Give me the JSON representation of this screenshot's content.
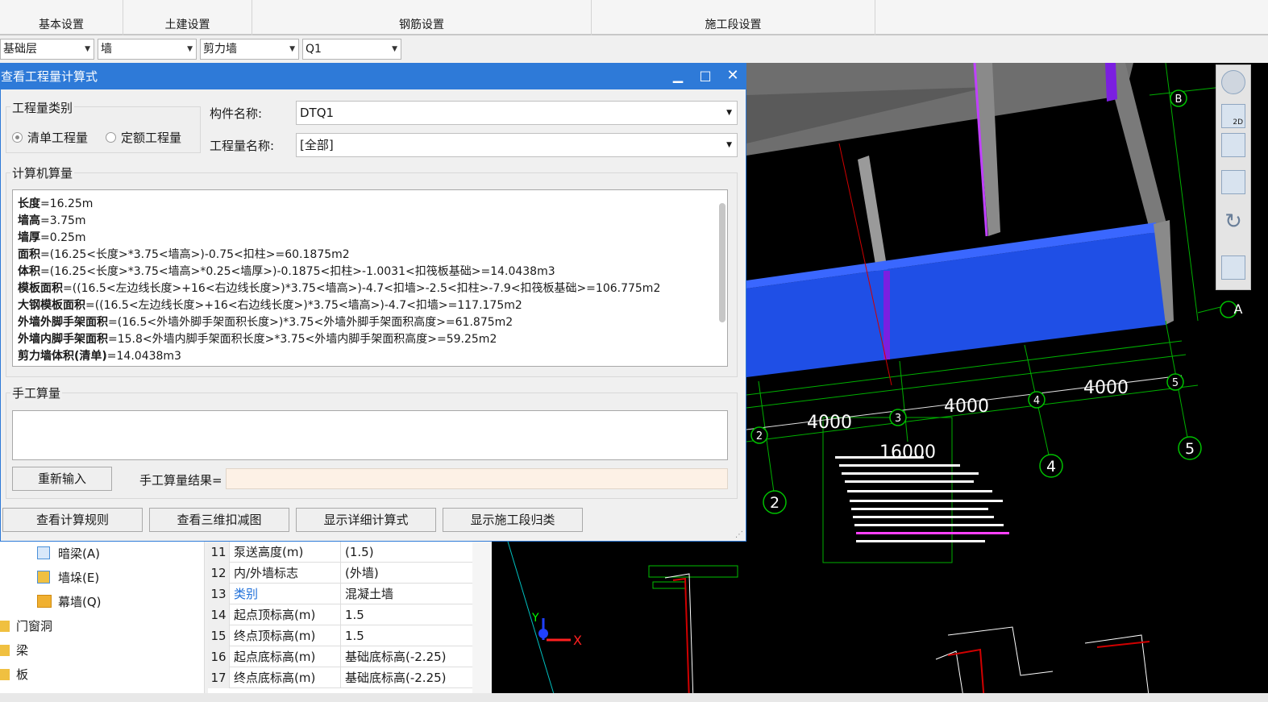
{
  "ribbon": {
    "groups": [
      "基本设置",
      "土建设置",
      "钢筋设置",
      "施工段设置"
    ]
  },
  "selectors": {
    "floor": "基础层",
    "category": "墙",
    "type": "剪力墙",
    "element": "Q1"
  },
  "dialog": {
    "title": "查看工程量计算式",
    "quantity_type": {
      "group_label": "工程量类别",
      "options": [
        "清单工程量",
        "定额工程量"
      ],
      "selected": "清单工程量"
    },
    "component_label": "构件名称:",
    "component_value": "DTQ1",
    "quantity_name_label": "工程量名称:",
    "quantity_name_value": "[全部]",
    "computer_calc_label": "计算机算量",
    "calc_lines": [
      {
        "key": "长度",
        "expr": "=16.25m"
      },
      {
        "key": "墙高",
        "expr": "=3.75m"
      },
      {
        "key": "墙厚",
        "expr": "=0.25m"
      },
      {
        "key": "面积",
        "expr": "=(16.25<长度>*3.75<墙高>)-0.75<扣柱>=60.1875m2"
      },
      {
        "key": "体积",
        "expr": "=(16.25<长度>*3.75<墙高>*0.25<墙厚>)-0.1875<扣柱>-1.0031<扣筏板基础>=14.0438m3"
      },
      {
        "key": "模板面积",
        "expr": "=((16.5<左边线长度>+16<右边线长度>)*3.75<墙高>)-4.7<扣墙>-2.5<扣柱>-7.9<扣筏板基础>=106.775m2"
      },
      {
        "key": "大钢模板面积",
        "expr": "=((16.5<左边线长度>+16<右边线长度>)*3.75<墙高>)-4.7<扣墙>=117.175m2"
      },
      {
        "key": "外墙外脚手架面积",
        "expr": "=(16.5<外墙外脚手架面积长度>)*3.75<外墙外脚手架面积高度>=61.875m2"
      },
      {
        "key": "外墙内脚手架面积",
        "expr": "=15.8<外墙内脚手架面积长度>*3.75<外墙内脚手架面积高度>=59.25m2"
      },
      {
        "key": "剪力墙体积(清单)",
        "expr": "=14.0438m3"
      }
    ],
    "manual_label": "手工算量",
    "reenter_button": "重新输入",
    "manual_result_label": "手工算量结果=",
    "buttons": [
      "查看计算规则",
      "查看三维扣减图",
      "显示详细计算式",
      "显示施工段归类"
    ]
  },
  "tree": {
    "items": [
      {
        "label": "暗梁(A)",
        "icon": "beam-icon"
      },
      {
        "label": "墙垛(E)",
        "icon": "pilaster-icon"
      },
      {
        "label": "幕墙(Q)",
        "icon": "curtain-wall-icon"
      },
      {
        "label": "门窗洞",
        "icon": "folder-icon"
      },
      {
        "label": "梁",
        "icon": "folder-icon"
      },
      {
        "label": "板",
        "icon": "folder-icon"
      }
    ]
  },
  "properties": {
    "rows": [
      {
        "n": "11",
        "k": "泵送高度(m)",
        "v": "(1.5)"
      },
      {
        "n": "12",
        "k": "内/外墙标志",
        "v": "(外墙)"
      },
      {
        "n": "13",
        "k": "类别",
        "v": "混凝土墙"
      },
      {
        "n": "14",
        "k": "起点顶标高(m)",
        "v": "1.5"
      },
      {
        "n": "15",
        "k": "终点顶标高(m)",
        "v": "1.5"
      },
      {
        "n": "16",
        "k": "起点底标高(m)",
        "v": "基础底标高(-2.25)"
      },
      {
        "n": "17",
        "k": "终点底标高(m)",
        "v": "基础底标高(-2.25)"
      }
    ]
  },
  "viewport": {
    "dims": [
      "4000",
      "4000",
      "4000",
      "16000"
    ],
    "axis_numbers": [
      "2",
      "3",
      "4",
      "5",
      "2",
      "4",
      "5"
    ],
    "axis_letters": [
      "B",
      "A"
    ],
    "axis_labels": {
      "x": "X",
      "y": "Y"
    },
    "tool_2d": "2D"
  },
  "colors": {
    "title_bar": "#2e7ad8",
    "wall_blue": "#1f4fe6",
    "cad_green": "#00c000",
    "result_bg": "#fdf1e6"
  }
}
